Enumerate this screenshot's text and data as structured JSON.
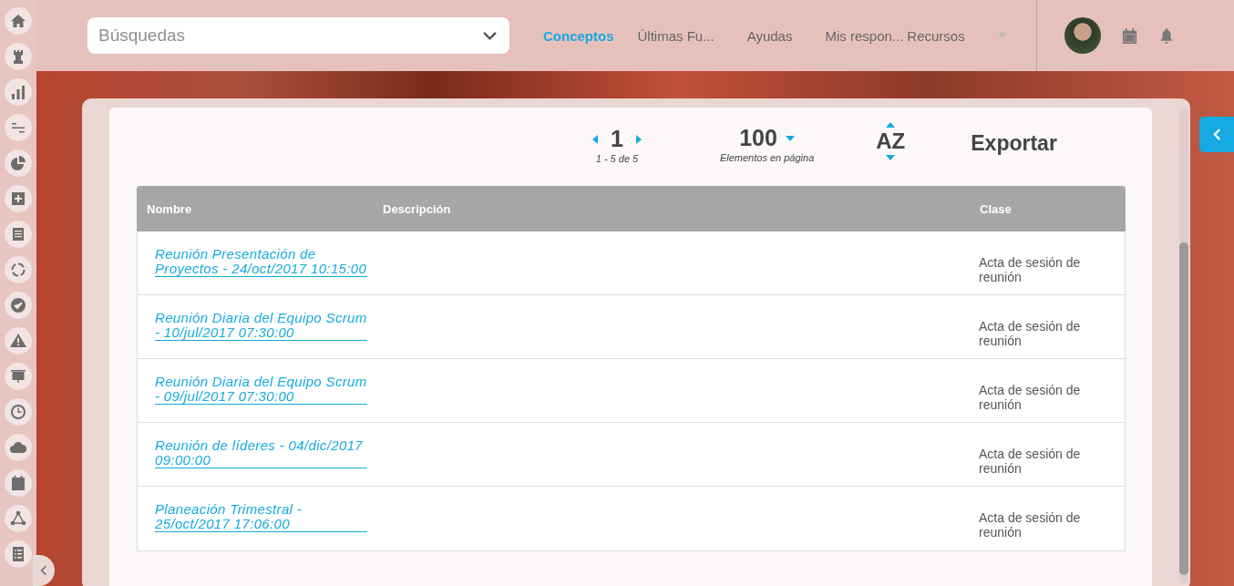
{
  "search": {
    "placeholder": "Búsquedas"
  },
  "nav": [
    {
      "label": "Conceptos",
      "selected": true
    },
    {
      "label": "Últimas Fu...",
      "selected": false
    },
    {
      "label": "Ayudas",
      "selected": false
    },
    {
      "label": "Mis respon...",
      "selected": false
    },
    {
      "label": "Recursos",
      "selected": false
    }
  ],
  "pagination": {
    "page": "1",
    "range": "1 - 5 de 5"
  },
  "page_size": {
    "value": "100",
    "label": "Elementos en página"
  },
  "sort": {
    "label": "AZ"
  },
  "export": {
    "label": "Exportar"
  },
  "table": {
    "columns": [
      "Nombre",
      "Descripción",
      "Clase"
    ],
    "rows": [
      {
        "nombre": "Reunión Presentación de Proyectos - 24/oct/2017 10:15:00",
        "clase": "Acta de sesión de reunión"
      },
      {
        "nombre": "Reunión Diaria del Equipo Scrum - 10/jul/2017 07:30:00",
        "clase": "Acta de sesión de reunión"
      },
      {
        "nombre": "Reunión Diaria del Equipo Scrum - 09/jul/2017 07:30:00",
        "clase": "Acta de sesión de reunión"
      },
      {
        "nombre": "Reunión de líderes - 04/dic/2017 09:00:00",
        "clase": "Acta de sesión de reunión"
      },
      {
        "nombre": "Planeación Trimestral - 25/oct/2017 17:06:00",
        "clase": "Acta de sesión de reunión"
      }
    ]
  }
}
